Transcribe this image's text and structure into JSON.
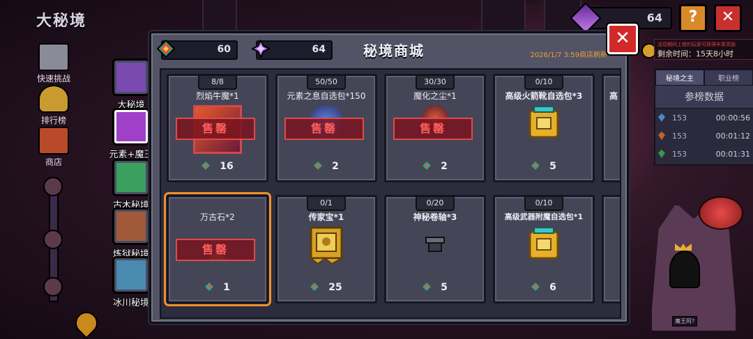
{
  "game": {
    "title": "大秘境"
  },
  "left_nav": [
    {
      "id": "quick",
      "label": "快速挑战",
      "icon": "quick-challenge-icon"
    },
    {
      "id": "rank",
      "label": "排行榜",
      "icon": "trophy-icon"
    },
    {
      "id": "shop",
      "label": "商店",
      "icon": "shop-icon"
    }
  ],
  "dungeons": [
    {
      "label": "大秘境",
      "color": "#7a4ab0"
    },
    {
      "label": "元素+魔王",
      "color": "#a040c8"
    },
    {
      "label": "古木秘境",
      "color": "#3aa060"
    },
    {
      "label": "炼狱秘境",
      "color": "#a05a3a"
    },
    {
      "label": "冰川秘境",
      "color": "#4a8ab0"
    }
  ],
  "hud": {
    "currency_value": "64",
    "help_label": "?",
    "close_label": "✕"
  },
  "right_panel": {
    "notice": "活动期间上榜的玩家可获得丰厚奖励",
    "remaining": "剩余时间：15天8小时",
    "tabs": [
      "秘境之主",
      "职业榜"
    ],
    "title": "参榜数据",
    "rows": [
      {
        "score": "153",
        "time": "00:00:56",
        "color": "#4a8ac8"
      },
      {
        "score": "153",
        "time": "00:01:12",
        "color": "#c8602a"
      },
      {
        "score": "153",
        "time": "00:01:31",
        "color": "#3a9a4a"
      }
    ]
  },
  "boss": {
    "label": "魔王阿?"
  },
  "shop": {
    "title": "秘境商城",
    "gem_currency": "60",
    "crystal_currency": "64",
    "refresh_text": "2026/1/7 3:59商店刷新",
    "close_label": "✕",
    "soldout_label": "售罄",
    "items": [
      {
        "limit": "8/8",
        "name": "烈焰牛魔*1",
        "price": "16",
        "sold_out": true,
        "art": "beast-card"
      },
      {
        "limit": "50/50",
        "name": "元素之息自选包*150",
        "price": "2",
        "sold_out": true,
        "art": "essence"
      },
      {
        "limit": "30/30",
        "name": "魔化之尘*1",
        "price": "2",
        "sold_out": true,
        "art": "dust"
      },
      {
        "limit": "0/10",
        "name": "高级火箭靴自选包*3",
        "price": "5",
        "sold_out": false,
        "art": "gold-chest"
      },
      {
        "limit": "",
        "name": "万古石*2",
        "price": "1",
        "sold_out": true,
        "art": "stone"
      },
      {
        "limit": "0/1",
        "name": "传家宝*1",
        "price": "25",
        "sold_out": false,
        "art": "heirloom"
      },
      {
        "limit": "0/20",
        "name": "神秘卷轴*3",
        "price": "5",
        "sold_out": false,
        "art": "scroll"
      },
      {
        "limit": "0/10",
        "name": "高级武器附魔自选包*1",
        "price": "6",
        "sold_out": false,
        "art": "gold-chest"
      }
    ],
    "partial_name": "高"
  }
}
